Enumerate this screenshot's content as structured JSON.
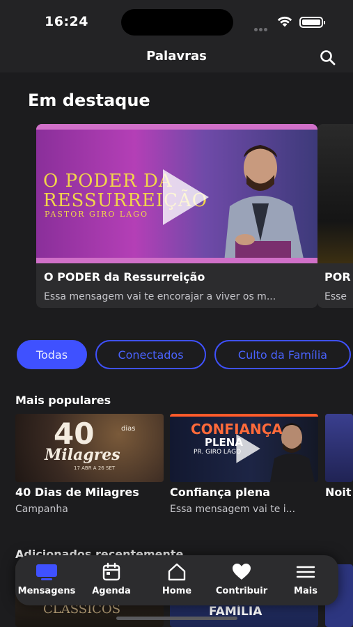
{
  "status": {
    "time": "16:24"
  },
  "nav": {
    "title": "Palavras",
    "search_icon": "search-icon"
  },
  "featured": {
    "title": "Em destaque",
    "items": [
      {
        "poster_title": "O PODER DA RESSURREIÇÃO",
        "poster_sub": "PASTOR GIRO LAGO",
        "title": "O PODER da Ressurreição",
        "description": "Essa mensagem vai te encorajar a viver os m..."
      },
      {
        "title": "POR",
        "description": "Esse"
      }
    ]
  },
  "filters": [
    {
      "label": "Todas",
      "active": true
    },
    {
      "label": "Conectados",
      "active": false
    },
    {
      "label": "Culto da Família",
      "active": false
    }
  ],
  "popular": {
    "title": "Mais populares",
    "items": [
      {
        "poster_big": "40",
        "poster_small": "dias",
        "poster_word": "Milagres",
        "poster_date": "17 ABR A 26 SET",
        "title": "40 Dias de Milagres",
        "description": "Campanha"
      },
      {
        "poster_big": "CONFIANÇA",
        "poster_word": "PLENA",
        "poster_sub": "PR. GIRO LAGO",
        "title": "Confiança plena",
        "description": "Essa mensagem vai te i..."
      },
      {
        "title": "Noit",
        "description": ""
      }
    ]
  },
  "recent": {
    "title": "Adicionados recentemente",
    "items": [
      {
        "poster_word": "CLÁSSICOS"
      },
      {
        "poster_word": "FAMÍLIA"
      }
    ]
  },
  "tabbar": [
    {
      "label": "Mensagens",
      "icon": "tv-icon",
      "active": true
    },
    {
      "label": "Agenda",
      "icon": "calendar-icon",
      "active": false
    },
    {
      "label": "Home",
      "icon": "home-icon",
      "active": false
    },
    {
      "label": "Contribuir",
      "icon": "heart-icon",
      "active": false
    },
    {
      "label": "Mais",
      "icon": "menu-icon",
      "active": false
    }
  ],
  "colors": {
    "background": "#1c1c1e",
    "accent": "#3f51ff",
    "poster_gold": "#f2d54a"
  }
}
